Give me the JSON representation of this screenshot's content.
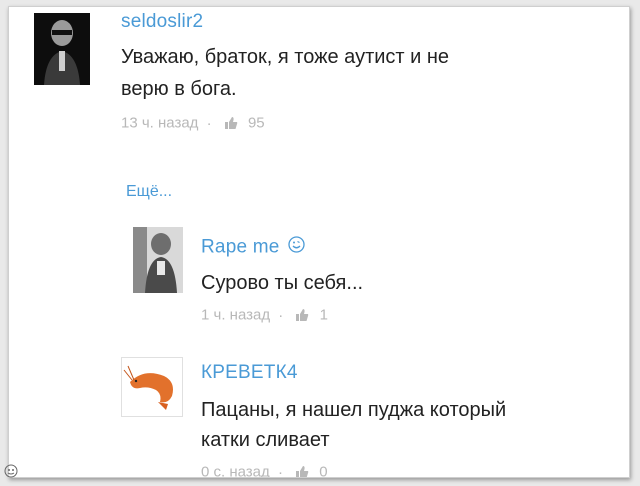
{
  "comments": [
    {
      "username": "seldoslir2",
      "text_lines": [
        "Уважаю, браток, я тоже аутист и не",
        "верю в бога."
      ],
      "time": "13 ч. назад",
      "separator": "·",
      "likes": "95"
    },
    {
      "username": "Rape me",
      "text_lines": [
        "Сурово ты себя..."
      ],
      "time": "1 ч. назад",
      "separator": "·",
      "likes": "1"
    },
    {
      "username": "КРЕВЕТК4",
      "text_lines": [
        "Пацаны, я нашел пуджа который",
        "катки сливает"
      ],
      "time": "0 с. назад",
      "separator": "·",
      "likes": "0"
    }
  ],
  "more_link": "Ещё...",
  "colors": {
    "username": "#4a9ad6",
    "text": "#222222",
    "meta": "#b8b8b8"
  },
  "icons": [
    "like-icon",
    "smiley-icon",
    "watermark-icon"
  ]
}
